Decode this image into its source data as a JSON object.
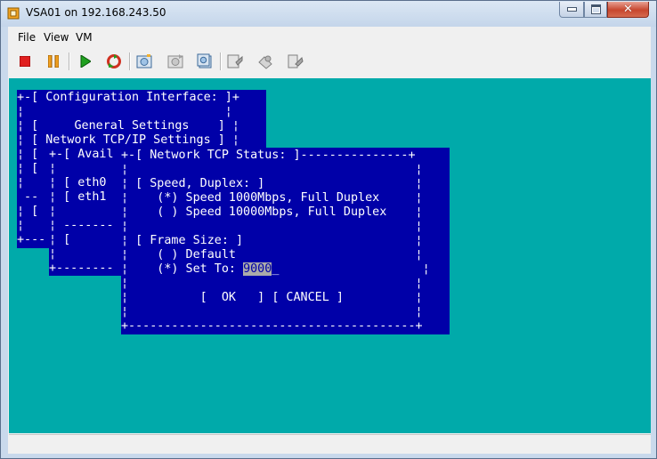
{
  "window": {
    "title": "VSA01 on 192.168.243.50"
  },
  "menu": {
    "items": [
      "File",
      "View",
      "VM"
    ]
  },
  "toolbar": {
    "buttons": [
      "stop-icon",
      "pause-icon",
      "play-icon",
      "reset-icon",
      "snapshot-icon",
      "revert-snapshot-icon",
      "manage-snapshots-icon",
      "console-settings-icon",
      "vm-options-icon",
      "connect-devices-icon"
    ]
  },
  "colors": {
    "console_bg": "#00aaaa",
    "dialog_bg": "#0000a8",
    "text": "#ffffff",
    "stop": "#e02020",
    "pause": "#f0a020",
    "play": "#20a020"
  },
  "console": {
    "config_menu": {
      "title_line": "+-[ Configuration Interface: ]+",
      "line2": "¦                            ¦",
      "general": "¦ [     General Settings    ] ¦",
      "tcpip": "¦ [ Network TCP/IP Settings ] ¦",
      "line5": "¦ [",
      "line6": "¦ [",
      "line7": "¦",
      "line8": " --",
      "line9": "¦ [",
      "line10": "¦",
      "bottom": "+---"
    },
    "avail_panel": {
      "title_line": "+-[ Avail",
      "blank1": "¦",
      "eth0": "¦ [ eth0",
      "eth1": "¦ [ eth1",
      "blank2": "¦",
      "sep": "¦ -------",
      "blank3": "¦",
      "bracket": "¦ [",
      "blank4": "¦",
      "bottom": "+--------"
    },
    "tcp_status": {
      "title": "+-[ Network TCP Status: ]---------------+",
      "blank": "¦                                        ¦",
      "speed_header": "¦ [ Speed, Duplex: ]                     ¦",
      "speed_1000": "¦    (*) Speed 1000Mbps, Full Duplex     ¦",
      "speed_10000": "¦    ( ) Speed 10000Mbps, Full Duplex    ¦",
      "frame_header": "¦ [ Frame Size: ]                        ¦",
      "frame_default": "¦    ( ) Default                         ¦",
      "frame_set_prefix": "¦    (*) Set To: ",
      "frame_set_value": "9000",
      "frame_set_cursor": "_",
      "frame_set_suffix": "                    ¦",
      "buttons_line_left": "¦          [  ",
      "ok_label": "OK",
      "buttons_line_mid": "   ] ",
      "cancel_label": "[ CANCEL ]",
      "buttons_line_right": "          ¦",
      "bottom": "+----------------------------------------+"
    }
  }
}
